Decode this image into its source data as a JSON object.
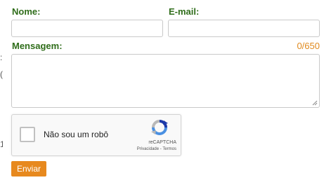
{
  "left_edge_fragments": [
    ":",
    "(",
    "1"
  ],
  "form": {
    "name_label": "Nome:",
    "name_value": "",
    "email_label": "E-mail:",
    "email_value": "",
    "message_label": "Mensagem:",
    "message_value": "",
    "message_counter": "0/650",
    "submit_label": "Enviar"
  },
  "recaptcha": {
    "checkbox_label": "Não sou um robô",
    "brand": "reCAPTCHA",
    "privacy_link": "Privacidade",
    "separator": " - ",
    "terms_link": "Termos",
    "checked": false
  },
  "colors": {
    "label_green": "#2f6d1a",
    "accent_orange": "#e7891e",
    "counter_orange": "#e08a1e"
  }
}
